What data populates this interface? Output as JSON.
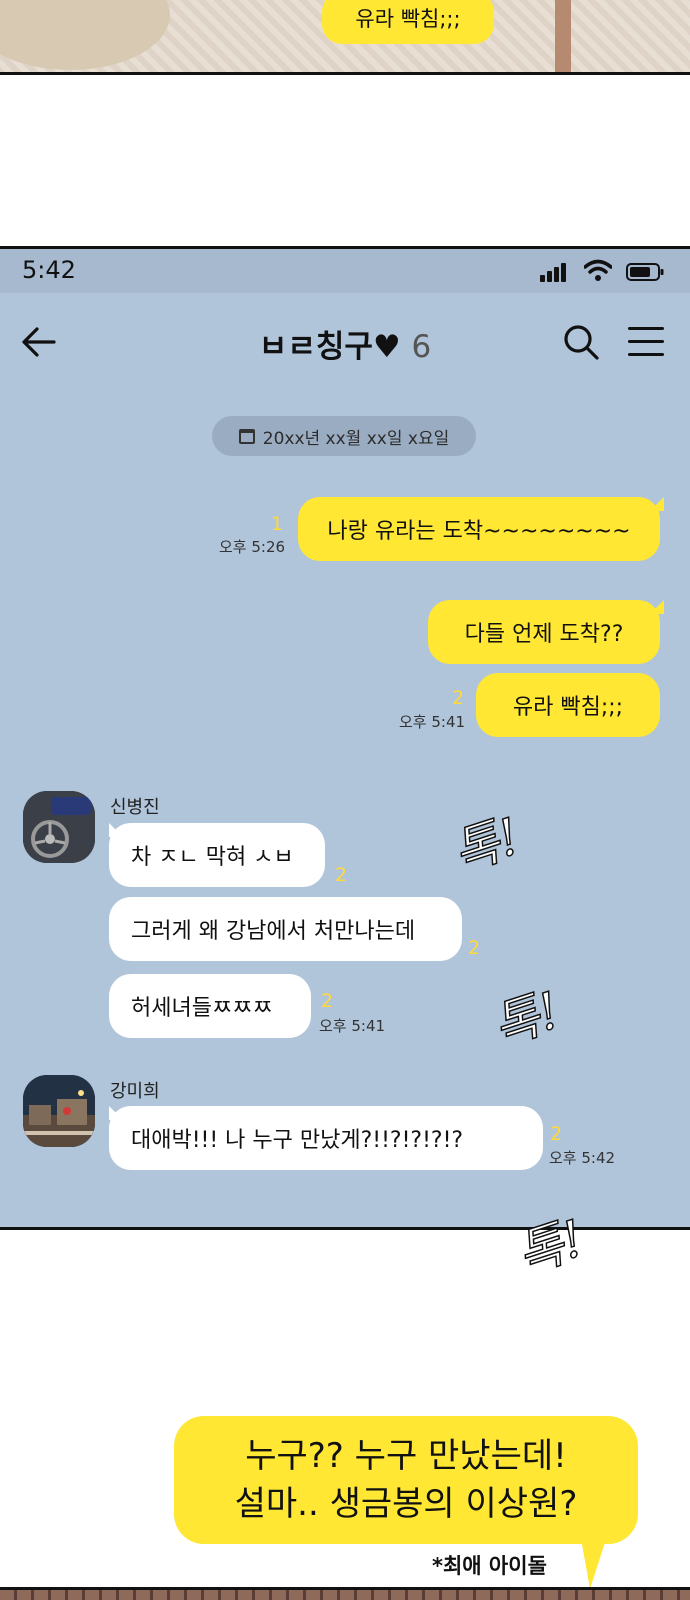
{
  "top_panel": {
    "bubble_text": "유라 빡침;;;"
  },
  "status_bar": {
    "time": "5:42"
  },
  "header": {
    "title": "ㅂㄹ칭구♥",
    "member_count": "6"
  },
  "date_separator": "20xx년 xx월 xx일 x요일",
  "my_messages": [
    {
      "text": "나랑 유라는 도착~~~~~~~~",
      "unread": "1",
      "time": "오후 5:26"
    },
    {
      "text": "다들 언제 도착??",
      "unread": "",
      "time": ""
    },
    {
      "text": "유라 빡침;;;",
      "unread": "2",
      "time": "오후 5:41"
    }
  ],
  "groups": [
    {
      "sender": "신병진",
      "messages": [
        {
          "text": "차 ㅈㄴ 막혀 ㅅㅂ",
          "unread": "2",
          "time": ""
        },
        {
          "text": "그러게 왜 강남에서 처만나는데",
          "unread": "2",
          "time": ""
        },
        {
          "text": "허세녀들ㅉㅉㅉ",
          "unread": "2",
          "time": "오후 5:41"
        }
      ]
    },
    {
      "sender": "강미희",
      "messages": [
        {
          "text": "대애박!!! 나 누구 만났게?!!?!?!?!?",
          "unread": "2",
          "time": "오후 5:42"
        }
      ]
    }
  ],
  "sfx": [
    "톡!",
    "톡!",
    "톡!"
  ],
  "narration": {
    "line1": "누구?? 누구 만났는데!",
    "line2": "설마.. 생금봉의 이상원?",
    "footnote": "*최애 아이돌"
  },
  "icons": [
    "back-arrow-icon",
    "search-icon",
    "menu-icon",
    "signal-icon",
    "wifi-icon",
    "battery-icon",
    "calendar-icon"
  ],
  "colors": {
    "chat_bg": "#b0c4da",
    "my_bubble": "#ffe734",
    "other_bubble": "#ffffff",
    "unread": "#ffd93a"
  }
}
